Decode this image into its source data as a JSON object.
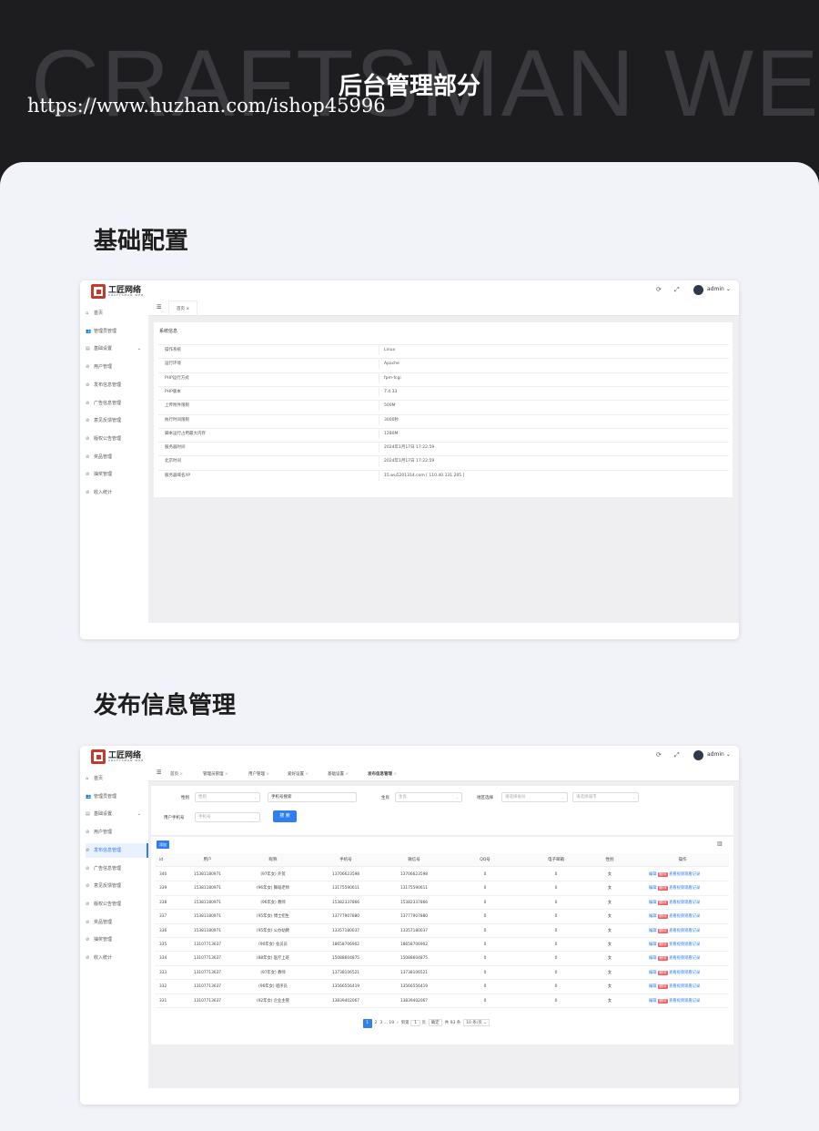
{
  "hero": {
    "bg_text": "CRAFTSMAN WE",
    "title": "后台管理部分",
    "url": "https://www.huzhan.com/ishop45996"
  },
  "sections": {
    "basic": "基础配置",
    "publish": "发布信息管理"
  },
  "app": {
    "brand": "工匠网络",
    "brand_sub": "CRAFTSMAN WEB",
    "user": "admin",
    "refresh_icon": "refresh-icon",
    "fullscreen_icon": "fullscreen-icon",
    "accent_color": "#2f7ff0"
  },
  "sidebar": [
    {
      "label": "首页",
      "icon": "home-icon",
      "glyph": "⌂"
    },
    {
      "label": "管理员管理",
      "icon": "users-icon",
      "glyph": "👥"
    },
    {
      "label": "基础设置",
      "icon": "doc-icon",
      "glyph": "▤",
      "arrow": "⌄"
    },
    {
      "label": "用户管理",
      "icon": "circle-check-icon",
      "glyph": "⊘"
    },
    {
      "label": "发布信息管理",
      "icon": "circle-check-icon",
      "glyph": "⊘"
    },
    {
      "label": "广告信息管理",
      "icon": "circle-check-icon",
      "glyph": "⊘"
    },
    {
      "label": "意见反馈管理",
      "icon": "circle-check-icon",
      "glyph": "⊘"
    },
    {
      "label": "版权公告管理",
      "icon": "circle-check-icon",
      "glyph": "⊘"
    },
    {
      "label": "奖品管理",
      "icon": "circle-check-icon",
      "glyph": "⊘"
    },
    {
      "label": "抽奖管理",
      "icon": "circle-check-icon",
      "glyph": "⊘"
    },
    {
      "label": "收入统计",
      "icon": "circle-check-icon",
      "glyph": "⊘"
    }
  ],
  "screen1": {
    "tab_home": "首页",
    "card_title": "系统信息",
    "rows": [
      {
        "k": "操作系统",
        "v": "Linux"
      },
      {
        "k": "运行环境",
        "v": "Apache"
      },
      {
        "k": "PHP运行方式",
        "v": "fpm-fcgi"
      },
      {
        "k": "PHP版本",
        "v": "7.4.33"
      },
      {
        "k": "上传附件限制",
        "v": "500M"
      },
      {
        "k": "执行时间限制",
        "v": "3000秒"
      },
      {
        "k": "脚本运行占用最大内存",
        "v": "1280M"
      },
      {
        "k": "服务器时间",
        "v": "2024年1月17日 17:22:59"
      },
      {
        "k": "北京时间",
        "v": "2024年1月17日 17:22:59"
      },
      {
        "k": "服务器域名/IP",
        "v": "15.wu5201314.com [ 110.40.131.205 ]"
      }
    ]
  },
  "screen2": {
    "tabs": [
      "首页",
      "管理员管理",
      "用户管理",
      "爱好设置",
      "基础设置",
      "发布信息管理"
    ],
    "filters": {
      "gender_label": "性别",
      "gender_ph": "性别",
      "phone_search_label": "手机号搜索",
      "zodiac_label": "生肖",
      "zodiac_ph": "生肖",
      "region_label": "地区选择",
      "province_ph": "请选择省份",
      "city_ph": "请选择城市",
      "user_phone_label": "用户手机号",
      "user_phone_ph": "手机号",
      "search_btn": "搜 索"
    },
    "add_btn": "添加",
    "columns": [
      "id",
      "用户",
      "昵称",
      "手机号",
      "微信号",
      "QQ号",
      "电子邮箱",
      "性别",
      "操作"
    ],
    "rows": [
      {
        "id": "340",
        "user": "15381180971",
        "nick": "(97年女) 外贸",
        "phone": "13706623598",
        "wx": "13706623598",
        "qq": "0",
        "email": "0",
        "sex": "女"
      },
      {
        "id": "339",
        "user": "15381180971",
        "nick": "(96年女) 舞蹈老师",
        "phone": "13175590611",
        "wx": "13175590611",
        "qq": "0",
        "email": "0",
        "sex": "女"
      },
      {
        "id": "338",
        "user": "15381180971",
        "nick": "(96年女) 教师",
        "phone": "15382337866",
        "wx": "15382337866",
        "qq": "0",
        "email": "0",
        "sex": "女"
      },
      {
        "id": "337",
        "user": "15381180971",
        "nick": "(95年女) 博士招生",
        "phone": "13777907880",
        "wx": "13777907880",
        "qq": "0",
        "email": "0",
        "sex": "女"
      },
      {
        "id": "336",
        "user": "15381180971",
        "nick": "(95年女) 公办幼教",
        "phone": "13357180037",
        "wx": "13357180037",
        "qq": "0",
        "email": "0",
        "sex": "女"
      },
      {
        "id": "335",
        "user": "13107713637",
        "nick": "(90年女) 会员员",
        "phone": "18658706902",
        "wx": "18658706902",
        "qq": "0",
        "email": "0",
        "sex": "女"
      },
      {
        "id": "334",
        "user": "13107713637",
        "nick": "(88年女) 医疗上班",
        "phone": "15088604875",
        "wx": "15088604875",
        "qq": "0",
        "email": "0",
        "sex": "女"
      },
      {
        "id": "333",
        "user": "13107713637",
        "nick": "(97年女) 教师",
        "phone": "13738106521",
        "wx": "13738106521",
        "qq": "0",
        "email": "0",
        "sex": "女"
      },
      {
        "id": "332",
        "user": "13107713637",
        "nick": "(96年女) 程序员",
        "phone": "13566556419",
        "wx": "13566556419",
        "qq": "0",
        "email": "0",
        "sex": "女"
      },
      {
        "id": "331",
        "user": "13107713637",
        "nick": "(92年女) 企业主管",
        "phone": "13839402067",
        "wx": "13839402067",
        "qq": "0",
        "email": "0",
        "sex": "女"
      }
    ],
    "ops": {
      "edit": "编辑",
      "del": "删除",
      "view": "查看视频观看记录"
    },
    "pager": {
      "p1": "1",
      "p2": "2",
      "p3": "3",
      "ellipsis": "...",
      "last": "19",
      "goto": "到第",
      "page_in": "1",
      "page": "页",
      "confirm": "确定",
      "total": "共 93 条",
      "size": "10 条/页"
    }
  }
}
